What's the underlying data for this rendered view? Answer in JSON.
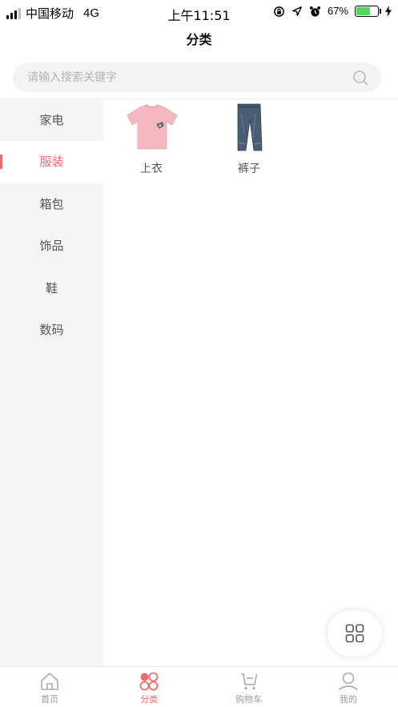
{
  "status_bar": {
    "carrier": "中国移动",
    "network": "4G",
    "time": "上午11:51",
    "battery_text": "67%",
    "battery_level": 0.67,
    "icons": [
      "signal-icon",
      "lock-rotation-icon",
      "location-icon",
      "alarm-icon",
      "battery-icon",
      "charging-icon"
    ]
  },
  "header": {
    "title": "分类"
  },
  "search": {
    "placeholder": "请输入搜索关键字",
    "value": ""
  },
  "sidebar": {
    "items": [
      {
        "label": "家电",
        "active": false
      },
      {
        "label": "服装",
        "active": true
      },
      {
        "label": "箱包",
        "active": false
      },
      {
        "label": "饰品",
        "active": false
      },
      {
        "label": "鞋",
        "active": false
      },
      {
        "label": "数码",
        "active": false
      }
    ]
  },
  "products": [
    {
      "name": "上衣",
      "image": "pink-tshirt"
    },
    {
      "name": "裤子",
      "image": "blue-jeans"
    }
  ],
  "floating_button": {
    "icon": "grid-icon"
  },
  "tabbar": {
    "tabs": [
      {
        "label": "首页",
        "icon": "home-icon",
        "active": false
      },
      {
        "label": "分类",
        "icon": "category-icon",
        "active": true
      },
      {
        "label": "购物车",
        "icon": "cart-icon",
        "active": false
      },
      {
        "label": "我的",
        "icon": "user-icon",
        "active": false
      }
    ]
  },
  "colors": {
    "accent": "#f56a6a",
    "sidebar_bg": "#f5f5f5",
    "search_bg": "#f3f3f3",
    "battery_green": "#4cd964"
  }
}
